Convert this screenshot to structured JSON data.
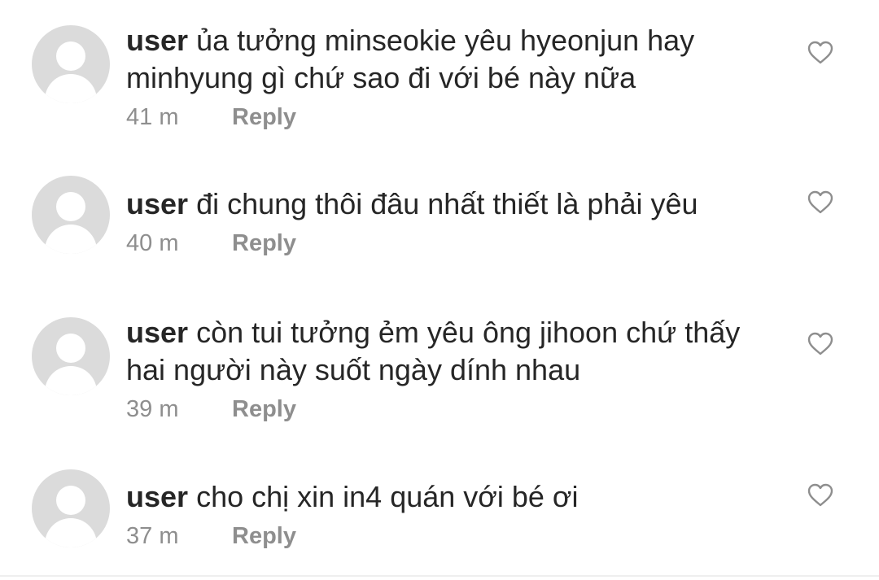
{
  "comments": [
    {
      "username": "user",
      "text": "ủa tưởng minseokie yêu hyeonjun hay minhyung gì chứ sao đi với bé này nữa",
      "time": "41 m",
      "reply_label": "Reply"
    },
    {
      "username": "user",
      "text": "đi chung thôi đâu nhất thiết là phải yêu",
      "time": "40 m",
      "reply_label": "Reply"
    },
    {
      "username": "user",
      "text": "còn tui tưởng ẻm yêu ông jihoon chứ thấy hai người này suốt ngày dính nhau",
      "time": "39 m",
      "reply_label": "Reply"
    },
    {
      "username": "user",
      "text": "cho chị xin in4 quán với bé ơi",
      "time": "37 m",
      "reply_label": "Reply"
    }
  ],
  "icons": {
    "avatar": "default-avatar-icon",
    "like": "heart-outline-icon"
  },
  "colors": {
    "text": "#262626",
    "muted": "#8e8e8e",
    "avatar_bg": "#dbdbdb",
    "divider": "#efefef"
  }
}
